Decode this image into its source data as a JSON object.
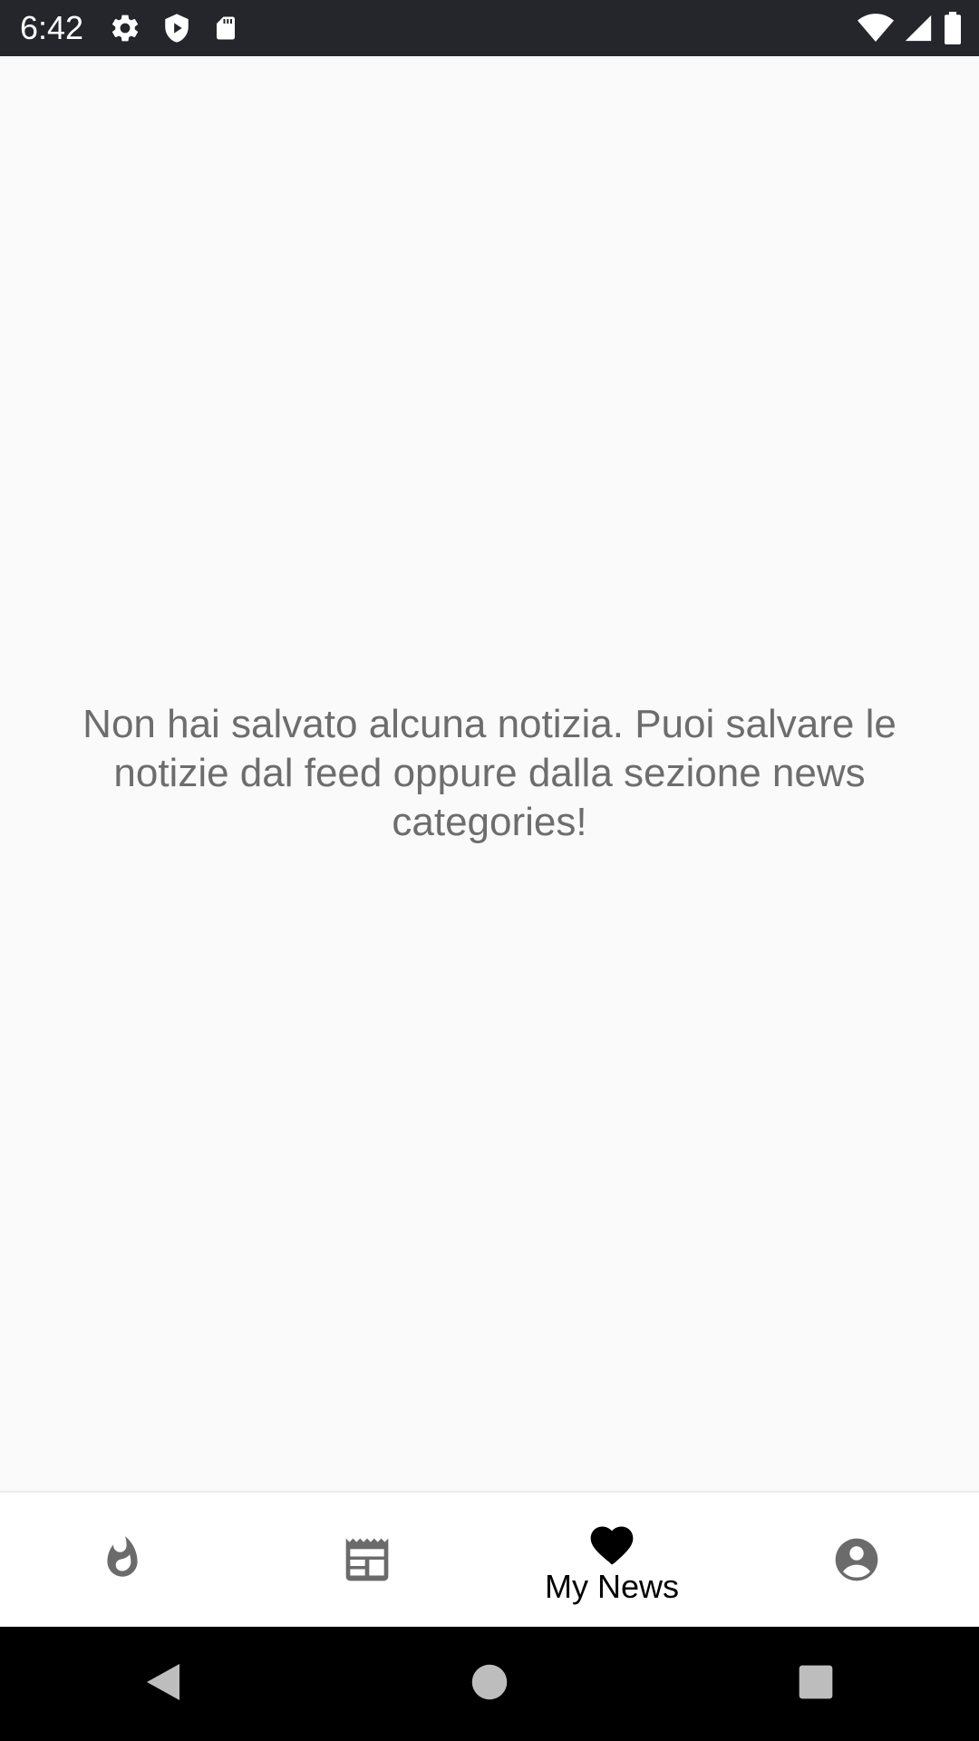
{
  "status_bar": {
    "time": "6:42",
    "left_icons": [
      "settings-icon",
      "shield-icon",
      "sd-card-icon"
    ],
    "right_icons": [
      "wifi-icon",
      "signal-icon",
      "battery-icon"
    ]
  },
  "main": {
    "empty_message": "Non hai salvato alcuna notizia. Puoi salvare le notizie dal feed oppure dalla sezione news categories!"
  },
  "bottom_nav": {
    "items": [
      {
        "icon": "flame-icon",
        "label": "",
        "active": false
      },
      {
        "icon": "newspaper-icon",
        "label": "",
        "active": false
      },
      {
        "icon": "heart-icon",
        "label": "My News",
        "active": true
      },
      {
        "icon": "account-circle-icon",
        "label": "",
        "active": false
      }
    ]
  },
  "system_nav": {
    "buttons": [
      "back-icon",
      "home-icon",
      "recents-icon"
    ]
  },
  "colors": {
    "status_bar_bg": "#24262b",
    "background": "#fafafa",
    "message_text": "#6d6d6d",
    "nav_inactive_icon": "#6b6b6b",
    "nav_active": "#000000"
  }
}
